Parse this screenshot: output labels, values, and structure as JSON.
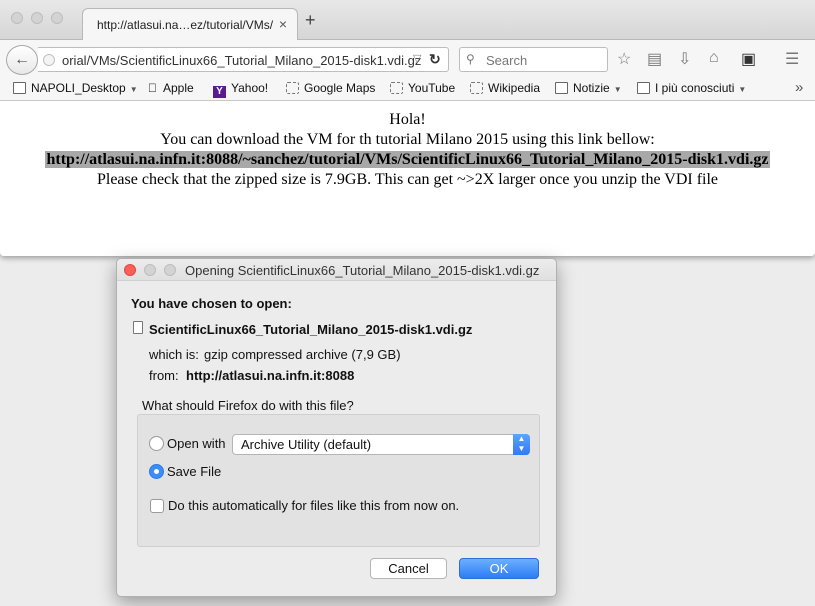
{
  "browser": {
    "tab": {
      "title": "http://atlasui.na…ez/tutorial/VMs/",
      "close": "×"
    },
    "new_tab": "+",
    "url": "orial/VMs/ScientificLinux66_Tutorial_Milano_2015-disk1.vdi.gz",
    "search_placeholder": "Search",
    "bookmarks": [
      {
        "label": "NAPOLI_Desktop",
        "icon": "folder-icon",
        "has_dropdown": true
      },
      {
        "label": "Apple",
        "icon": "apple-icon"
      },
      {
        "label": "Yahoo!",
        "icon": "yahoo-icon"
      },
      {
        "label": "Google Maps",
        "icon": "page-icon"
      },
      {
        "label": "YouTube",
        "icon": "page-icon"
      },
      {
        "label": "Wikipedia",
        "icon": "page-icon"
      },
      {
        "label": "Notizie",
        "icon": "folder-icon",
        "has_dropdown": true
      },
      {
        "label": "I più conosciuti",
        "icon": "folder-icon",
        "has_dropdown": true
      }
    ],
    "overflow": "»"
  },
  "page": {
    "line1": "Hola!",
    "line2": "You can download the VM for th tutorial Milano 2015 using this link bellow:",
    "link": "http://atlasui.na.infn.it:8088/~sanchez/tutorial/VMs/ScientificLinux66_Tutorial_Milano_2015-disk1.vdi.gz",
    "line4": "Please check that the zipped size is 7.9GB. This can get ~>2X larger once you unzip the VDI file"
  },
  "dialog": {
    "title": "Opening ScientificLinux66_Tutorial_Milano_2015-disk1.vdi.gz",
    "heading": "You have chosen to open:",
    "file_name": "ScientificLinux66_Tutorial_Milano_2015-disk1.vdi.gz",
    "which_label": "which is:",
    "which_value": "gzip compressed archive (7,9 GB)",
    "from_label": "from:",
    "from_value": "http://atlasui.na.infn.it:8088",
    "question": "What should Firefox do with this file?",
    "open_with_label": "Open with",
    "open_with_app": "Archive Utility (default)",
    "save_file_label": "Save File",
    "selected_option": "save_file",
    "auto_label": "Do this automatically for files like this from now on.",
    "auto_checked": false,
    "cancel_label": "Cancel",
    "ok_label": "OK"
  },
  "colors": {
    "accent": "#3b8dfb",
    "link_highlight": "#a8a8a8",
    "close_red": "#fc5f57"
  }
}
